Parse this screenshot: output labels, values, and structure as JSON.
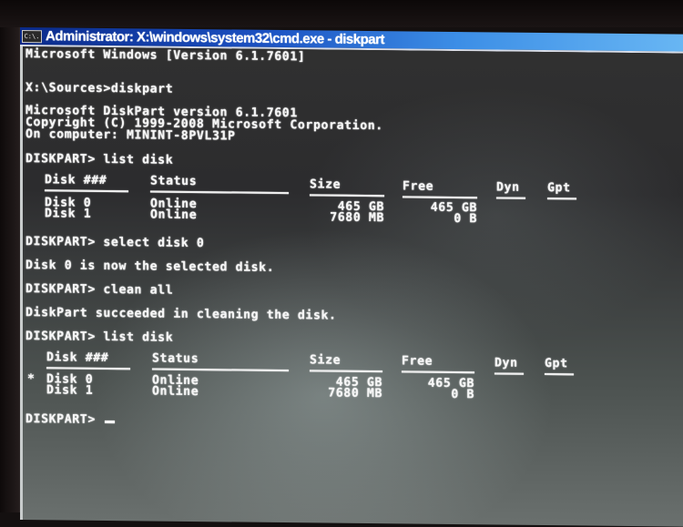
{
  "window": {
    "title": "Administrator: X:\\windows\\system32\\cmd.exe - diskpart",
    "icon_label": "C:\\."
  },
  "console": {
    "lines": {
      "banner": "Microsoft Windows [Version 6.1.7601]",
      "prompt_diskpart": "X:\\Sources>diskpart",
      "dp_version": "Microsoft DiskPart version 6.1.7601",
      "copyright": "Copyright (C) 1999-2008 Microsoft Corporation.",
      "computer": "On computer: MININT-8PVL31P",
      "cmd_list1": "DISKPART> list disk",
      "cmd_select": "DISKPART> select disk 0",
      "msg_selected": "Disk 0 is now the selected disk.",
      "cmd_clean": "DISKPART> clean all",
      "msg_clean": "DiskPart succeeded in cleaning the disk.",
      "cmd_list2": "DISKPART> list disk",
      "final_prompt": "DISKPART> "
    },
    "table_headers": {
      "disk": "Disk ###",
      "status": "Status",
      "size": "Size",
      "free": "Free",
      "dyn": "Dyn",
      "gpt": "Gpt"
    },
    "table1": [
      {
        "marker": "",
        "disk": "Disk 0",
        "status": "Online",
        "size": "465 GB",
        "free": "465 GB",
        "dyn": "",
        "gpt": ""
      },
      {
        "marker": "",
        "disk": "Disk 1",
        "status": "Online",
        "size": "7680 MB",
        "free": "0 B",
        "dyn": "",
        "gpt": ""
      }
    ],
    "table2": [
      {
        "marker": "*",
        "disk": "Disk 0",
        "status": "Online",
        "size": "465 GB",
        "free": "465 GB",
        "dyn": "",
        "gpt": ""
      },
      {
        "marker": "",
        "disk": "Disk 1",
        "status": "Online",
        "size": "7680 MB",
        "free": "0 B",
        "dyn": "",
        "gpt": ""
      }
    ]
  },
  "colors": {
    "titlebar_start": "#0a2a8a",
    "titlebar_end": "#6ab8f4",
    "console_text": "#f6f6f6",
    "console_bg": "#2c2c2e"
  }
}
